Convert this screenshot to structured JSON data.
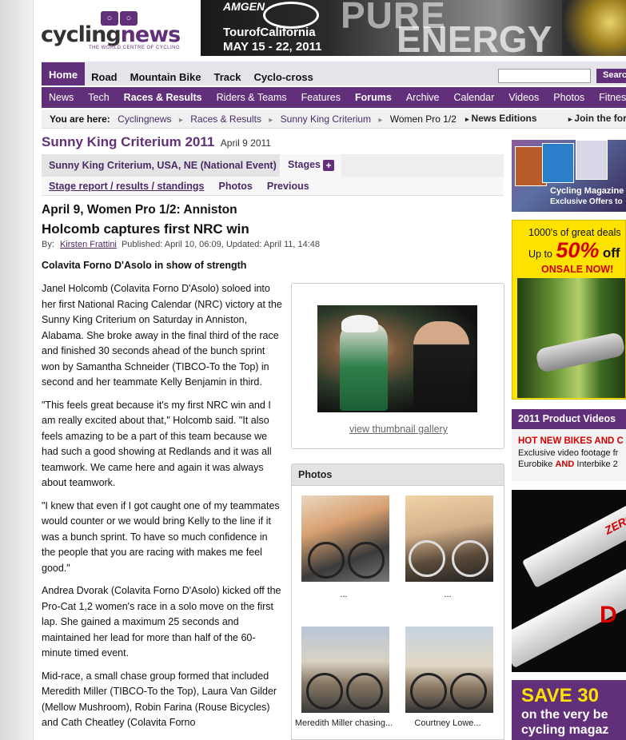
{
  "header": {
    "logo_a": "cycling",
    "logo_b": "news",
    "logo_tagline": "THE WORLD CENTRE OF CYCLING",
    "banner": {
      "amgen": "AMGEN",
      "tour": "TourofCalifornia",
      "dates": "MAY 15 - 22, 2011",
      "pure": "PURE",
      "energy": "ENERGY"
    }
  },
  "nav_primary": [
    "Home",
    "Road",
    "Mountain Bike",
    "Track",
    "Cyclo-cross"
  ],
  "search": {
    "placeholder": "",
    "button": "Search"
  },
  "nav_secondary": [
    "News",
    "Tech",
    "Races & Results",
    "Riders & Teams",
    "Features",
    "Forums",
    "Archive",
    "Calendar",
    "Videos",
    "Photos",
    "Fitness"
  ],
  "breadcrumb": {
    "label": "You are here:",
    "items": [
      "Cyclingnews",
      "Races & Results",
      "Sunny King Criterium",
      "Women Pro 1/2"
    ],
    "news_editions": "News Editions",
    "join_forum": "Join the forum"
  },
  "event": {
    "title": "Sunny King Criterium 2011",
    "date": "April 9 2011",
    "tab_event": "Sunny King Criterium, USA, NE (National Event)",
    "tab_stages": "Stages",
    "subtabs": [
      "Stage report / results / standings",
      "Photos",
      "Previous"
    ]
  },
  "article": {
    "stage_title": "April 9, Women Pro 1/2: Anniston",
    "headline": "Holcomb captures first NRC win",
    "by_label": "By:",
    "author": "Kirsten Frattini",
    "published": "Published:  April 10, 06:09,  Updated:  April 11, 14:48",
    "lead": "Colavita Forno D'Asolo in show of strength",
    "paragraphs": [
      "Janel Holcomb (Colavita Forno D'Asolo) soloed into her first National Racing Calendar (NRC) victory at the Sunny King Criterium on Saturday in Anniston, Alabama. She broke away in the final third of the race and finished 30 seconds ahead of the bunch sprint won by Samantha Schneider (TIBCO-To the Top) in second and her teammate Kelly Benjamin in third.",
      "\"This feels great because it's my first NRC win and I am really excited about that,\" Holcomb said. \"It also feels amazing to be a part of this team because we had such a good showing at Redlands and it was all teamwork. We came here and again it was always about teamwork.",
      "\"I knew that even if I got caught one of my teammates would counter or we would bring Kelly to the line if it was a bunch sprint. To have so much confidence in the people that you are racing with makes me feel good.\"",
      "Andrea Dvorak (Colavita Forno D'Asolo) kicked off the Pro-Cat 1,2 women's race in a solo move on the first lap. She gained a maximum 25 seconds and maintained her lead for more than half of the 60-minute timed event.",
      "Mid-race, a small chase group formed that included Meredith Miller (TIBCO-To the Top), Laura Van Gilder (Mellow Mushroom), Robin Farina (Rouse Bicycles) and Cath Cheatley (Colavita Forno"
    ]
  },
  "photobox": {
    "view_gallery": "view thumbnail gallery"
  },
  "photos": {
    "heading": "Photos",
    "captions": [
      "...",
      "...",
      "Meredith Miller chasing...",
      "Courtney Lowe..."
    ]
  },
  "sidebar": {
    "ad_mags": {
      "title": "Cycling Magazine",
      "sub": "Exclusive Offers to"
    },
    "ad_deals": {
      "line1": "1000's of great deals",
      "upto": "Up to",
      "percent": "50%",
      "off": "off",
      "onsale": "ONSALE NOW!"
    },
    "product_videos": {
      "heading": "2011 Product Videos",
      "line1": "HOT NEW BIKES AND C",
      "line2": "Exclusive video footage fr",
      "line3a": "Eurobike",
      "line3b": "AND",
      "line3c": "Interbike 2"
    },
    "ad_tube": {
      "brand": "ZERO",
      "red": "D"
    },
    "ad_save": {
      "line1": "SAVE 30",
      "line2": "on the very be",
      "line3": "cycling magaz"
    }
  },
  "colors": {
    "brand_purple": "#62307a",
    "accent_red": "#d40000",
    "ad_yellow": "#ffe300"
  }
}
